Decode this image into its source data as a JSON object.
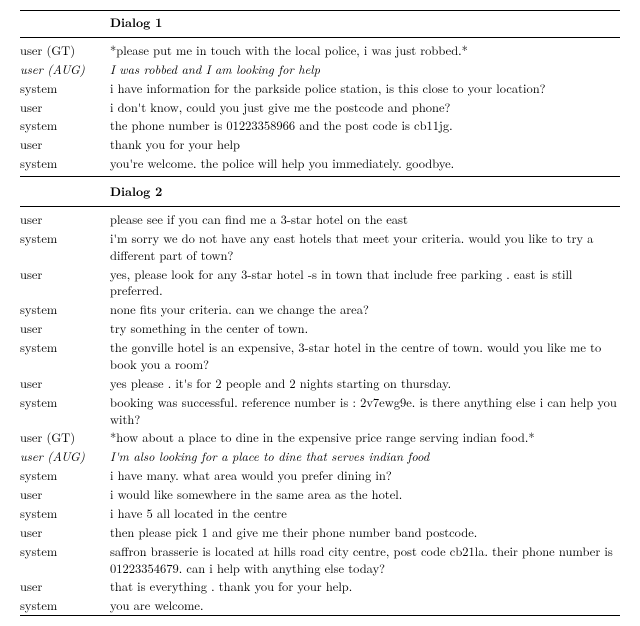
{
  "dialogs": [
    {
      "header": "Dialog 1",
      "rows": [
        {
          "who": "user (GT)",
          "cls": "gt",
          "text": "please put me in touch with the local police, i was just robbed."
        },
        {
          "who": "user (AUG)",
          "cls": "aug",
          "text": "I was robbed and I am looking for help"
        },
        {
          "who": "system",
          "cls": "",
          "text": "i have information for the parkside police station, is this close to your location?"
        },
        {
          "who": "user",
          "cls": "",
          "text": "i don't know, could you just give me the postcode and phone?"
        },
        {
          "who": "system",
          "cls": "",
          "text": "the phone number is 01223358966 and the post code is cb11jg."
        },
        {
          "who": "user",
          "cls": "",
          "text": "thank you for your help"
        },
        {
          "who": "system",
          "cls": "",
          "text": "you're welcome. the police will help you immediately. goodbye."
        }
      ]
    },
    {
      "header": "Dialog 2",
      "rows": [
        {
          "who": "user",
          "cls": "",
          "text": "please see if you can find me a 3-star hotel on the east"
        },
        {
          "who": "system",
          "cls": "",
          "text": "i'm sorry we do not have any east hotels that meet your criteria. would you like to try a different part of town?"
        },
        {
          "who": "user",
          "cls": "",
          "text": "yes, please look for any 3-star hotel -s in town that include free parking . east is still preferred."
        },
        {
          "who": "system",
          "cls": "",
          "text": "none fits your criteria. can we change the area?"
        },
        {
          "who": "user",
          "cls": "",
          "text": "try something in the center of town."
        },
        {
          "who": "system",
          "cls": "",
          "text": "the gonville hotel is an expensive, 3-star hotel in the centre of town. would you like me to book you a room?"
        },
        {
          "who": "user",
          "cls": "",
          "text": "yes please . it's for 2 people and 2 nights starting on thursday."
        },
        {
          "who": "system",
          "cls": "",
          "text": "booking was successful.  reference number is :  2v7ewg9e.  is there anything else i can help you with?"
        },
        {
          "who": "user (GT)",
          "cls": "gt",
          "text": "how about a place to dine in the expensive price range serving indian food."
        },
        {
          "who": "user (AUG)",
          "cls": "aug",
          "text": "I'm also looking for a place to dine that serves indian food"
        },
        {
          "who": "system",
          "cls": "",
          "text": "i have many. what area would you prefer dining in?"
        },
        {
          "who": "user",
          "cls": "",
          "text": "i would like somewhere in the same area as the hotel."
        },
        {
          "who": "system",
          "cls": "",
          "text": "i have 5 all located in the centre"
        },
        {
          "who": "user",
          "cls": "",
          "text": "then please pick 1 and give me their phone number band postcode."
        },
        {
          "who": "system",
          "cls": "",
          "text": "saffron brasserie is located at hills road city centre, post code cb21la. their phone number is 01223354679. can i help with anything else today?"
        },
        {
          "who": "user",
          "cls": "",
          "text": "that is everything . thank you for your help."
        },
        {
          "who": "system",
          "cls": "",
          "text": "you are welcome."
        }
      ]
    }
  ]
}
